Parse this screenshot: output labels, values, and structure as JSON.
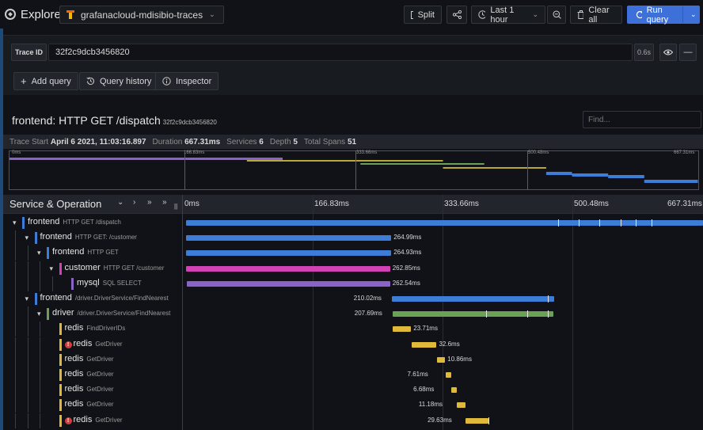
{
  "nav": {
    "title": "Explore",
    "datasource": "grafanacloud-mdisibio-traces",
    "split": "Split",
    "time_range": "Last 1 hour",
    "clear_all": "Clear all",
    "run_query": "Run query"
  },
  "query": {
    "label": "Trace ID",
    "value": "32f2c9dcb3456820",
    "time": "0.6s",
    "add_query": "Add query",
    "query_history": "Query history",
    "inspector": "Inspector"
  },
  "trace": {
    "service": "frontend: HTTP GET /dispatch",
    "id": "32f2c9dcb3456820",
    "find_placeholder": "Find...",
    "meta": {
      "start_label": "Trace Start",
      "start_value": "April 6 2021, 11:03:16.897",
      "duration_label": "Duration",
      "duration_value": "667.31ms",
      "services_label": "Services",
      "services_value": "6",
      "depth_label": "Depth",
      "depth_value": "5",
      "spans_label": "Total Spans",
      "spans_value": "51"
    },
    "minimap_ticks": [
      "0ms",
      "166.83ms",
      "333.66ms",
      "500.48ms",
      "667.31ms"
    ]
  },
  "timeline": {
    "header": "Service & Operation",
    "ticks": [
      "0ms",
      "166.83ms",
      "333.66ms",
      "500.48ms",
      "667.31ms"
    ],
    "total_ms": 667.31
  },
  "colors": {
    "frontend": "#3d7dd8",
    "customer": "#d142b5",
    "mysql": "#8a63c9",
    "driver": "#6aa155",
    "redis": "#e0b93a",
    "error": "#d23d3d"
  },
  "spans": [
    {
      "service": "frontend",
      "operation": "HTTP GET /dispatch",
      "depth": 0,
      "twisty": "▾",
      "start_ms": 0,
      "duration_ms": 667.31,
      "duration_label": "",
      "error": false
    },
    {
      "service": "frontend",
      "operation": "HTTP GET: /customer",
      "depth": 1,
      "twisty": "▾",
      "start_ms": 0,
      "duration_ms": 264.99,
      "duration_label": "264.99ms",
      "error": false
    },
    {
      "service": "frontend",
      "operation": "HTTP GET",
      "depth": 2,
      "twisty": "▾",
      "start_ms": 0,
      "duration_ms": 264.93,
      "duration_label": "264.93ms",
      "error": false
    },
    {
      "service": "customer",
      "operation": "HTTP GET /customer",
      "depth": 3,
      "twisty": "▾",
      "start_ms": 0.5,
      "duration_ms": 262.85,
      "duration_label": "262.85ms",
      "error": false
    },
    {
      "service": "mysql",
      "operation": "SQL SELECT",
      "depth": 4,
      "twisty": "",
      "start_ms": 0.8,
      "duration_ms": 262.54,
      "duration_label": "262.54ms",
      "error": false
    },
    {
      "service": "frontend",
      "operation": "/driver.DriverService/FindNearest",
      "depth": 1,
      "twisty": "▾",
      "start_ms": 265.5,
      "duration_ms": 210.02,
      "duration_label": "210.02ms",
      "error": false
    },
    {
      "service": "driver",
      "operation": "/driver.DriverService/FindNearest",
      "depth": 2,
      "twisty": "▾",
      "start_ms": 266.5,
      "duration_ms": 207.69,
      "duration_label": "207.69ms",
      "error": false
    },
    {
      "service": "redis",
      "operation": "FindDriverIDs",
      "depth": 3,
      "twisty": "",
      "start_ms": 266.8,
      "duration_ms": 23.71,
      "duration_label": "23.71ms",
      "error": false
    },
    {
      "service": "redis",
      "operation": "GetDriver",
      "depth": 3,
      "twisty": "",
      "start_ms": 290.8,
      "duration_ms": 32.6,
      "duration_label": "32.6ms",
      "error": true
    },
    {
      "service": "redis",
      "operation": "GetDriver",
      "depth": 3,
      "twisty": "",
      "start_ms": 323.6,
      "duration_ms": 10.86,
      "duration_label": "10.86ms",
      "error": false
    },
    {
      "service": "redis",
      "operation": "GetDriver",
      "depth": 3,
      "twisty": "",
      "start_ms": 334.7,
      "duration_ms": 7.61,
      "duration_label": "7.61ms",
      "error": false
    },
    {
      "service": "redis",
      "operation": "GetDriver",
      "depth": 3,
      "twisty": "",
      "start_ms": 342.5,
      "duration_ms": 6.68,
      "duration_label": "6.68ms",
      "error": false
    },
    {
      "service": "redis",
      "operation": "GetDriver",
      "depth": 3,
      "twisty": "",
      "start_ms": 349.4,
      "duration_ms": 11.18,
      "duration_label": "11.18ms",
      "error": false
    },
    {
      "service": "redis",
      "operation": "GetDriver",
      "depth": 3,
      "twisty": "",
      "start_ms": 360.8,
      "duration_ms": 29.63,
      "duration_label": "29.63ms",
      "error": true
    }
  ]
}
